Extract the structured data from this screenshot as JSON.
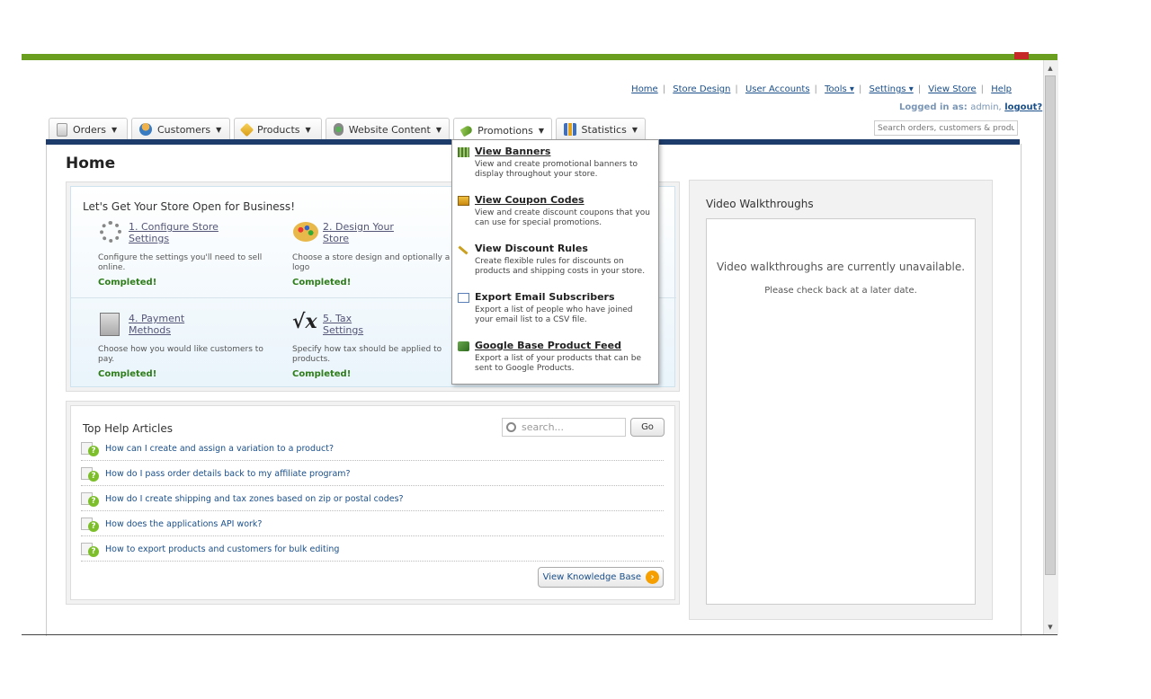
{
  "header": {
    "links": [
      "Home",
      "Store Design",
      "User Accounts",
      "Tools ▾",
      "Settings ▾",
      "View Store",
      "Help"
    ],
    "logged_in_label": "Logged in as:",
    "logged_in_user": "admin,",
    "logout": "logout?",
    "search_placeholder": "Search orders, customers & produc"
  },
  "tabs": [
    {
      "label": "Orders"
    },
    {
      "label": "Customers"
    },
    {
      "label": "Products"
    },
    {
      "label": "Website Content"
    },
    {
      "label": "Promotions"
    },
    {
      "label": "Statistics"
    }
  ],
  "page_title": "Home",
  "getting_started": {
    "title": "Let's Get Your Store Open for Business!",
    "steps": [
      {
        "link": "1. Configure Store Settings",
        "desc": "Configure the settings you'll need to sell online.",
        "status": "Completed!"
      },
      {
        "link": "2. Design Your Store",
        "desc": "Choose a store design and optionally a logo",
        "status": "Completed!"
      },
      {
        "link": "4. Payment Methods",
        "desc": "Choose how you would like customers to pay.",
        "status": "Completed!"
      },
      {
        "link": "5. Tax Settings",
        "desc": "Specify how tax should be applied to products.",
        "status": "Completed!"
      }
    ]
  },
  "help": {
    "title": "Top Help Articles",
    "search_placeholder": "search...",
    "go_label": "Go",
    "articles": [
      "How can I create and assign a variation to a product?",
      "How do I pass order details back to my affiliate program?",
      "How do I create shipping and tax zones based on zip or postal codes?",
      "How does the applications API work?",
      "How to export products and customers for bulk editing"
    ],
    "kb_button": "View Knowledge Base"
  },
  "video": {
    "title": "Video Walkthroughs",
    "message": "Video walkthroughs are currently unavailable.",
    "submessage": "Please check back at a later date."
  },
  "promotions_menu": [
    {
      "title": "View Banners",
      "desc": "View and create promotional banners to display throughout your store.",
      "underline": true
    },
    {
      "title": "View Coupon Codes",
      "desc": "View and create discount coupons that you can use for special promotions.",
      "underline": true
    },
    {
      "title": "View Discount Rules",
      "desc": "Create flexible rules for discounts on products and shipping costs in your store.",
      "underline": false
    },
    {
      "title": "Export Email Subscribers",
      "desc": "Export a list of people who have joined your email list to a CSV file.",
      "underline": false
    },
    {
      "title": "Google Base Product Feed",
      "desc": "Export a list of your products that can be sent to Google Products.",
      "underline": true
    }
  ],
  "colors": {
    "accent_green": "#6a9e1f",
    "nav_dark": "#1d3b6b",
    "completed": "#2e7d1a",
    "go_icon": "#f5a000"
  }
}
